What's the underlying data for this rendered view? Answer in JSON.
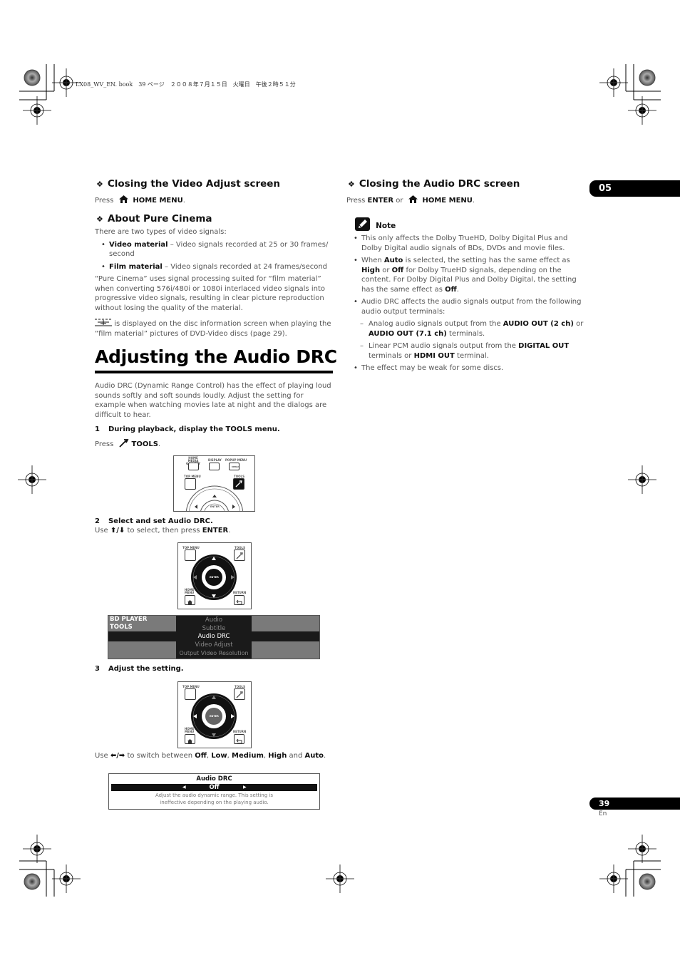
{
  "print_header": "LX08_WV_EN. book　39 ページ　２００８年７月１５日　火曜日　午後２時５１分",
  "chapter_tab": "05",
  "page_number": "39",
  "page_lang": "En",
  "left": {
    "sec1": {
      "title": "Closing the Video Adjust screen",
      "press": "Press",
      "key": "HOME MENU",
      "period": "."
    },
    "sec2": {
      "title": "About Pure Cinema",
      "intro": "There are two types of video signals:",
      "bullets": [
        {
          "bold": "Video material",
          "text": " – Video signals recorded at 25 or 30 frames/ second"
        },
        {
          "bold": "Film material",
          "text": " – Video signals recorded at 24 frames/second"
        }
      ],
      "para1": "“Pure Cinema” uses signal processing suited for “film material” when converting 576i/480i or 1080i interlaced video signals into progressive video signals, resulting in clear picture reproduction without losing the quality of the material.",
      "para2": " is displayed on the disc information screen when playing the “film material” pictures of DVD-Video discs (page 29)."
    },
    "main_title": "Adjusting the Audio DRC",
    "intro": "Audio DRC (Dynamic Range Control) has the effect of playing loud sounds softly and soft sounds loudly. Adjust the setting for example when watching movies late at night and the dialogs are difficult to hear.",
    "step1": {
      "num": "1",
      "text": "During playback, display the TOOLS menu.",
      "press": "Press",
      "key": "TOOLS",
      "period": "."
    },
    "remote1": {
      "labels": [
        "HOME MEDIA GALLERY",
        "DISPLAY",
        "POPUP MENU",
        "TOP MENU",
        "TOOLS",
        "MENU",
        "ENTER"
      ]
    },
    "step2": {
      "num": "2",
      "text": "Select and set Audio DRC.",
      "use": "Use",
      "arrows": "⬆/⬇",
      "mid": " to select, then press ",
      "key": "ENTER",
      "period": "."
    },
    "remote2": {
      "labels": [
        "TOP MENU",
        "TOOLS",
        "HOME MENU",
        "RETURN",
        "ENTER"
      ]
    },
    "tools_menu": {
      "header_line1": "BD PLAYER",
      "header_line2": "TOOLS",
      "items": [
        "Audio",
        "Subtitle",
        "Audio DRC",
        "Video Adjust",
        "Output Video Resolution"
      ],
      "selected": "Audio DRC"
    },
    "step3": {
      "num": "3",
      "text": "Adjust the setting."
    },
    "remote3": {
      "labels": [
        "TOP MENU",
        "TOOLS",
        "HOME MENU",
        "RETURN",
        "ENTER"
      ]
    },
    "step3_use": {
      "use": "Use",
      "arrows": "⬅/➡",
      "mid": " to switch between ",
      "opt1": "Off",
      "sep1": ", ",
      "opt2": "Low",
      "sep2": ", ",
      "opt3": "Medium",
      "sep3": ", ",
      "opt4": "High",
      "sep4": " and ",
      "opt5": "Auto",
      "period": "."
    },
    "drc_setting": {
      "title": "Audio DRC",
      "value": "Off",
      "desc1": "Adjust the audio dynamic range. This setting is",
      "desc2": "ineffective depending on the playing audio."
    }
  },
  "right": {
    "sec1": {
      "title": "Closing the Audio DRC screen",
      "press": "Press ",
      "key1": "ENTER",
      "or": " or",
      "key2": "HOME MENU",
      "period": "."
    },
    "note": {
      "title": "Note",
      "b1": "This only affects the Dolby TrueHD, Dolby Digital Plus and Dolby Digital audio signals of BDs, DVDs and movie files.",
      "b2": {
        "t1": "When ",
        "k1": "Auto",
        "t2": " is selected, the setting has the same effect as ",
        "k2": "High",
        "t3": " or ",
        "k3": "Off",
        "t4": " for Dolby TrueHD signals, depending on the content. For Dolby Digital Plus and Dolby Digital, the setting has the same effect as ",
        "k4": "Off",
        "t5": "."
      },
      "b3": "Audio DRC affects the audio signals output from the following audio output terminals:",
      "d1": {
        "t1": "Analog audio signals output from the ",
        "k1": "AUDIO OUT (2 ch)",
        "t2": " or ",
        "k2": "AUDIO OUT (7.1 ch)",
        "t3": " terminals."
      },
      "d2": {
        "t1": "Linear PCM audio signals output from the ",
        "k1": "DIGITAL OUT",
        "t2": " terminals or ",
        "k2": "HDMI OUT",
        "t3": " terminal."
      },
      "b4": "The effect may be weak for some discs."
    }
  }
}
